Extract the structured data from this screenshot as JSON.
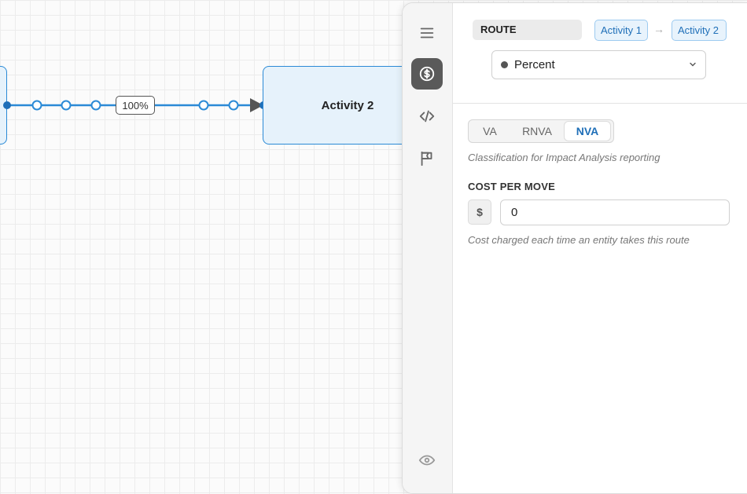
{
  "canvas": {
    "target_node_label": "Activity 2",
    "edge_label": "100%"
  },
  "sidebar": {
    "items": [
      {
        "icon": "menu-icon",
        "active": false
      },
      {
        "icon": "dollar-icon",
        "active": true
      },
      {
        "icon": "code-icon",
        "active": false
      },
      {
        "icon": "flag-icon",
        "active": false
      },
      {
        "icon": "eye-icon",
        "active": false
      }
    ]
  },
  "panel": {
    "header": "ROUTE",
    "from_chip": "Activity 1",
    "to_chip": "Activity 2",
    "routing_mode": "Percent",
    "classification": {
      "options": [
        "VA",
        "RNVA",
        "NVA"
      ],
      "selected": "NVA",
      "hint": "Classification for Impact Analysis reporting"
    },
    "cost": {
      "label": "COST PER MOVE",
      "currency": "$",
      "value": "0",
      "hint": "Cost charged each time an entity takes this route"
    }
  },
  "colors": {
    "accent": "#1f6fb8",
    "edge": "#2b8ad6",
    "node_fill": "#e6f2fb",
    "active_rail": "#5a5a5a"
  }
}
